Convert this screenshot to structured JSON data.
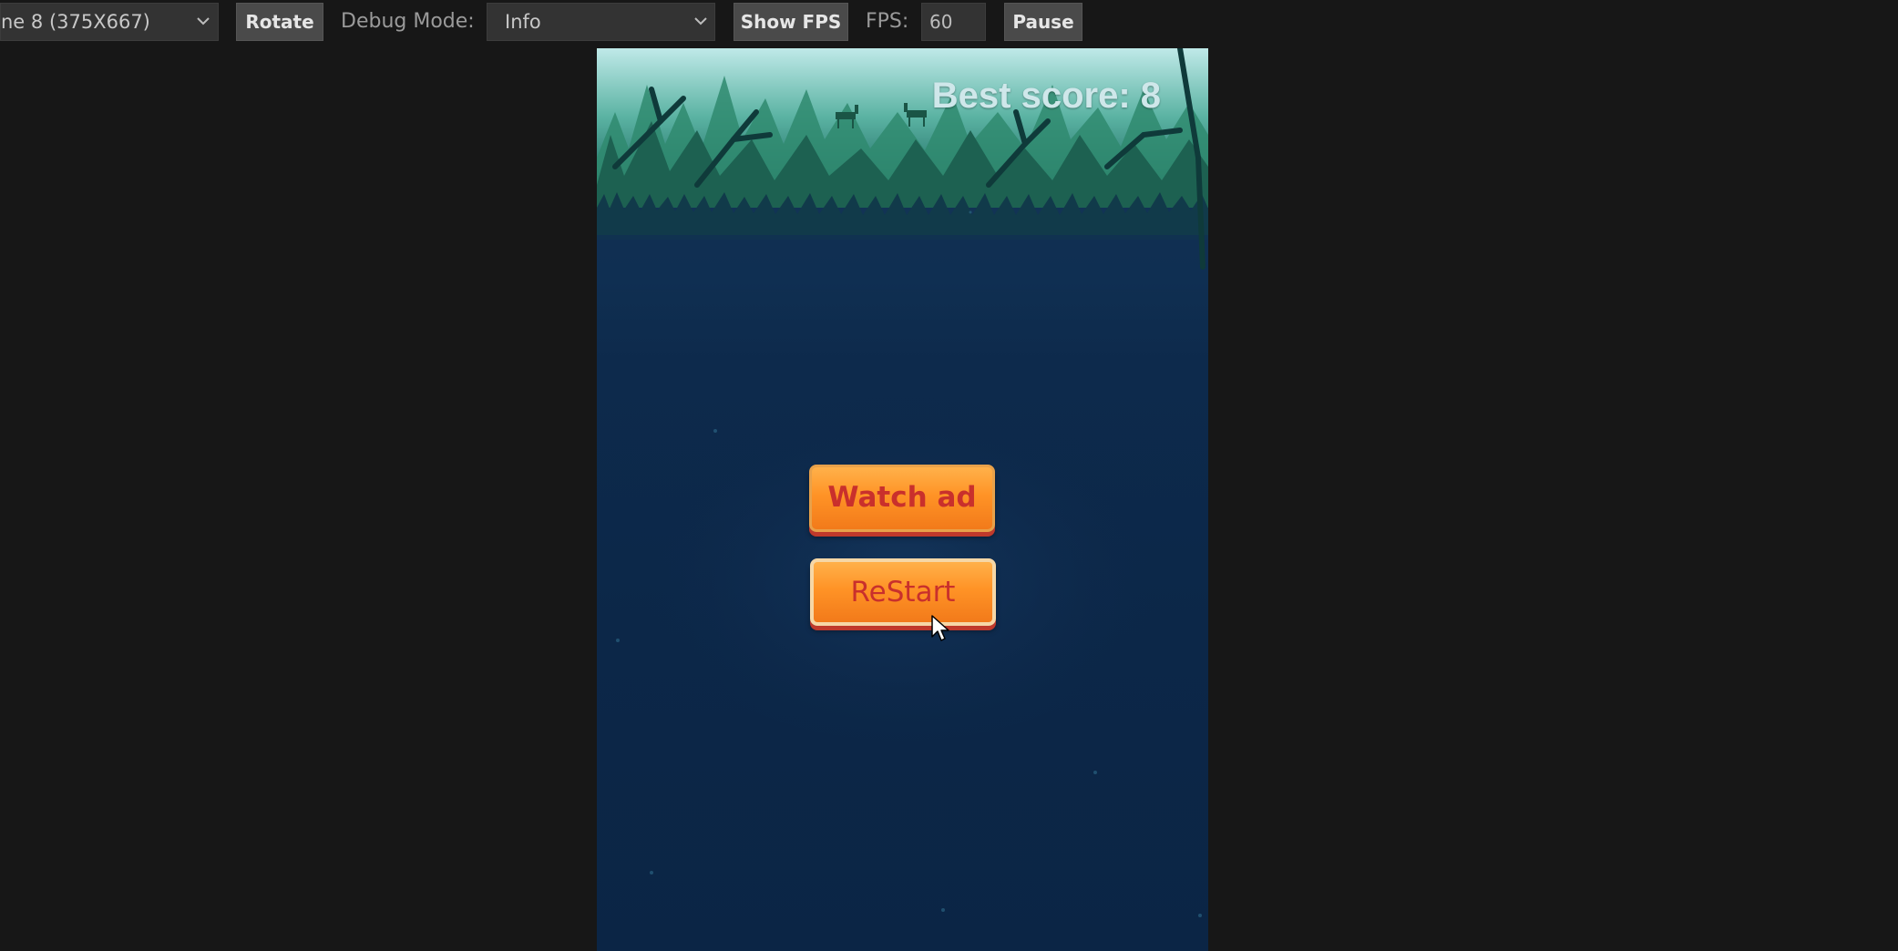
{
  "toolbar": {
    "device_select": "ne 8 (375X667)",
    "rotate_label": "Rotate",
    "debug_mode_label": "Debug Mode:",
    "debug_mode_value": "Info",
    "show_fps_label": "Show FPS",
    "fps_label": "FPS:",
    "fps_value": "60",
    "pause_label": "Pause"
  },
  "game": {
    "best_score": "Best score: 8",
    "watch_ad_label": "Watch ad",
    "restart_label": "ReStart"
  },
  "icons": {
    "dropdown": "chevron-down-icon",
    "cursor": "mouse-pointer-icon"
  },
  "colors": {
    "app_background": "#171717",
    "button_orange": "#ff9326",
    "button_text": "#c9302c",
    "score_text": "#cfe7ea"
  }
}
